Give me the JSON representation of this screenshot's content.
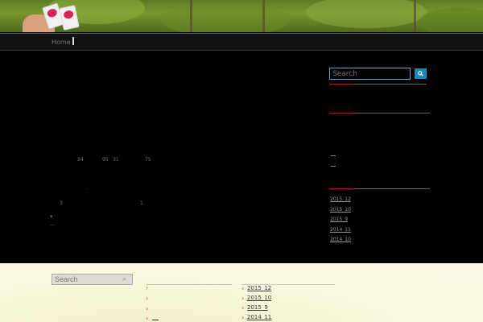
{
  "nav": {
    "home_label": "Home"
  },
  "content": {
    "numbers": [
      "24",
      "95",
      "31",
      "75",
      "3",
      "1"
    ]
  },
  "sidebar": {
    "search_placeholder": "Search",
    "archive_links": [
      "2015_12",
      "2015_10",
      "2015_9",
      "2014_11",
      "2014_10"
    ]
  },
  "footer": {
    "search_placeholder": "Search",
    "archive_links": [
      "2015_12",
      "2015_10",
      "2015_9",
      "2014_11"
    ]
  },
  "colors": {
    "accent_blue": "#1e86b8",
    "accent_red": "#a32020",
    "chevron_red": "#d13b2a"
  }
}
